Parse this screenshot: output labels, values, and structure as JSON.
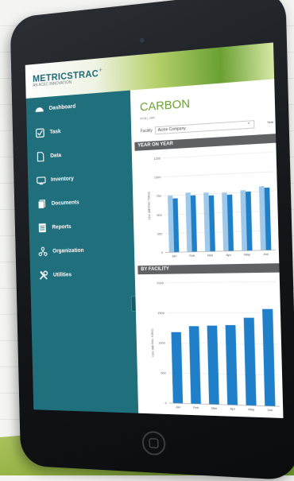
{
  "app": {
    "logo": "METRICSTRAC",
    "logo_suffix": "+",
    "logo_subtitle": "AN ACEC INNOVATION"
  },
  "sidebar": {
    "items": [
      {
        "label": "Dashboard",
        "icon": "dashboard-icon"
      },
      {
        "label": "Task",
        "icon": "checkbox-icon"
      },
      {
        "label": "Data",
        "icon": "document-icon"
      },
      {
        "label": "Inventory",
        "icon": "monitor-icon"
      },
      {
        "label": "Documents",
        "icon": "documents-icon"
      },
      {
        "label": "Reports",
        "icon": "reports-icon"
      },
      {
        "label": "Organization",
        "icon": "organization-icon"
      },
      {
        "label": "Utilities",
        "icon": "tools-icon"
      }
    ]
  },
  "main": {
    "title": "CARBON",
    "breadcrumb": "PCB  |  JAN",
    "facility_label": "Facility",
    "facility_value": "Acme Company",
    "year_label": "Year"
  },
  "colors": {
    "sidebar": "#1f6f7d",
    "accent_green": "#6aa033",
    "bar_dark": "#1f7fc8",
    "bar_light": "#9fc9ea"
  },
  "chart_data": [
    {
      "title": "YEAR ON YEAR",
      "type": "bar",
      "ylabel": "CO2 (METRIC TONS)",
      "ylim": [
        0,
        1250
      ],
      "yticks": [
        "0",
        "250",
        "500",
        "750",
        "1000",
        "1250"
      ],
      "categories": [
        "Jan",
        "Feb",
        "Mar",
        "Apr",
        "May",
        "Jun"
      ],
      "series": [
        {
          "values": [
            750,
            780,
            770,
            760,
            780,
            820
          ]
        },
        {
          "values": [
            710,
            740,
            730,
            730,
            760,
            800
          ]
        }
      ]
    },
    {
      "title": "BY FACILITY",
      "type": "bar",
      "ylabel": "CO2 (METRIC TONS)",
      "ylim": [
        0,
        2000
      ],
      "yticks": [
        "0",
        "500",
        "1000",
        "1500",
        "2000"
      ],
      "categories": [
        "Jan",
        "Feb",
        "Mar",
        "Apr",
        "May",
        "Jun"
      ],
      "values": [
        1180,
        1280,
        1290,
        1300,
        1420,
        1560
      ]
    }
  ]
}
